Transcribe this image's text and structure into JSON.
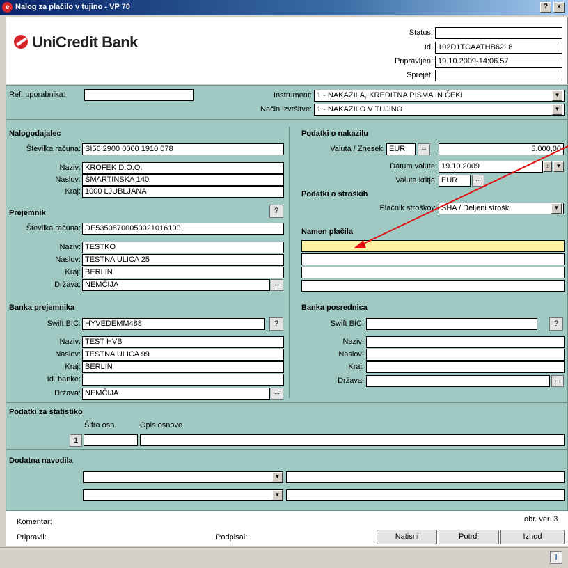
{
  "window": {
    "title": "Nalog za plačilo v tujino - VP 70",
    "help_btn": "?",
    "close_btn": "x",
    "app_icon": "e"
  },
  "logo": {
    "text": "UniCredit Bank",
    "color": "#d8262b"
  },
  "header": {
    "status_label": "Status:",
    "status_value": "",
    "id_label": "Id:",
    "id_value": "102D1TCAATHB62L8",
    "pripravljen_label": "Pripravljen:",
    "pripravljen_value": "19.10.2009-14:06.57",
    "sprejet_label": "Sprejet:",
    "sprejet_value": ""
  },
  "ref": {
    "label": "Ref. uporabnika:",
    "value": ""
  },
  "instrument": {
    "label": "Instrument:",
    "value": "1 - NAKAZILA, KREDITNA PISMA IN ČEKI"
  },
  "nacin": {
    "label": "Način izvršitve:",
    "value": "1 - NAKAZILO V TUJINO"
  },
  "nalogodajalec": {
    "title": "Nalogodajalec",
    "racun_label": "Številka računa:",
    "racun": "SI56 2900 0000 1910 078",
    "naziv_label": "Naziv:",
    "naziv": "KROFEK D.O.O.",
    "naslov_label": "Naslov:",
    "naslov": "ŠMARTINSKA 140",
    "kraj_label": "Kraj:",
    "kraj": "1000 LJUBLJANA"
  },
  "prejemnik": {
    "title": "Prejemnik",
    "help": "?",
    "racun_label": "Številka računa:",
    "racun": "DE53508700050021016100",
    "naziv_label": "Naziv:",
    "naziv": "TESTKO",
    "naslov_label": "Naslov:",
    "naslov": "TESTNA ULICA 25",
    "kraj_label": "Kraj:",
    "kraj": "BERLIN",
    "drzava_label": "Država:",
    "drzava": "NEMČIJA",
    "dots": "..."
  },
  "banka_prejemnika": {
    "title": "Banka prejemnika",
    "swift_label": "Swift BIC:",
    "swift": "HYVEDEMM488",
    "help": "?",
    "naziv_label": "Naziv:",
    "naziv": "TEST HVB",
    "naslov_label": "Naslov:",
    "naslov": "TESTNA ULICA 99",
    "kraj_label": "Kraj:",
    "kraj": "BERLIN",
    "idbanke_label": "Id. banke:",
    "idbanke": "",
    "drzava_label": "Država:",
    "drzava": "NEMČIJA",
    "dots": "..."
  },
  "nakazilo": {
    "title": "Podatki o nakazilu",
    "valuta_label": "Valuta / Znesek:",
    "valuta": "EUR",
    "dots": "...",
    "znesek": "5.000,00",
    "datum_label": "Datum valute:",
    "datum": "19.10.2009",
    "kritja_label": "Valuta kritja:",
    "kritja": "EUR"
  },
  "stroski": {
    "title": "Podatki o stroških",
    "placnik_label": "Plačnik stroškov:",
    "placnik": "SHA / Deljeni stroški"
  },
  "namen": {
    "title": "Namen plačila",
    "lines": [
      "",
      "",
      "",
      ""
    ]
  },
  "posrednica": {
    "title": "Banka posrednica",
    "swift_label": "Swift BIC:",
    "swift": "",
    "help": "?",
    "naziv_label": "Naziv:",
    "naslov_label": "Naslov:",
    "kraj_label": "Kraj:",
    "drzava_label": "Država:",
    "dots": "..."
  },
  "statistika": {
    "title": "Podatki za statistiko",
    "sifra_header": "Šifra osn.",
    "opis_header": "Opis osnove",
    "row_num": "1"
  },
  "dodatna": {
    "title": "Dodatna navodila"
  },
  "footer": {
    "komentar_label": "Komentar:",
    "pripravil_label": "Pripravil:",
    "podpisal_label": "Podpisal:",
    "version": "obr. ver. 3",
    "natisni": "Natisni",
    "potrdi": "Potrdi",
    "izhod": "Izhod",
    "info_icon": "i"
  }
}
